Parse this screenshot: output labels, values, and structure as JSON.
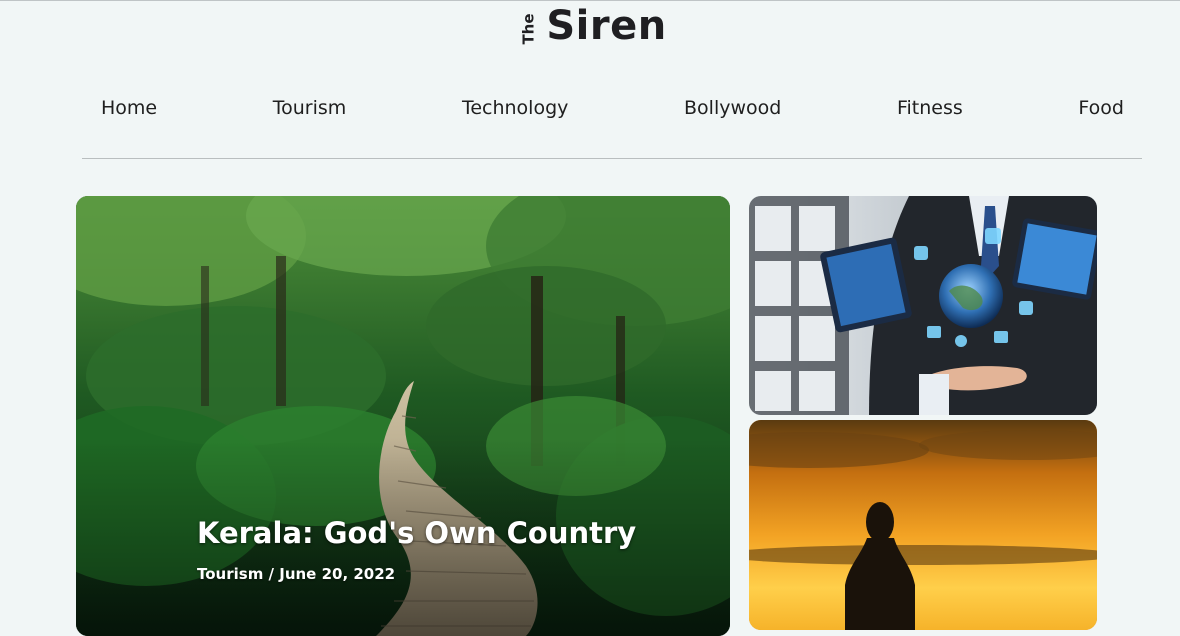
{
  "header": {
    "logo_prefix": "The",
    "logo_name": "Siren"
  },
  "nav": {
    "items": [
      "Home",
      "Tourism",
      "Technology",
      "Bollywood",
      "Fitness",
      "Food"
    ]
  },
  "featured": {
    "title": "Kerala: God's Own Country",
    "meta": "Tourism / June 20, 2022"
  },
  "side_cards": [
    {
      "image": "technology-businessman-tablet"
    },
    {
      "image": "sunset-silhouette"
    }
  ]
}
